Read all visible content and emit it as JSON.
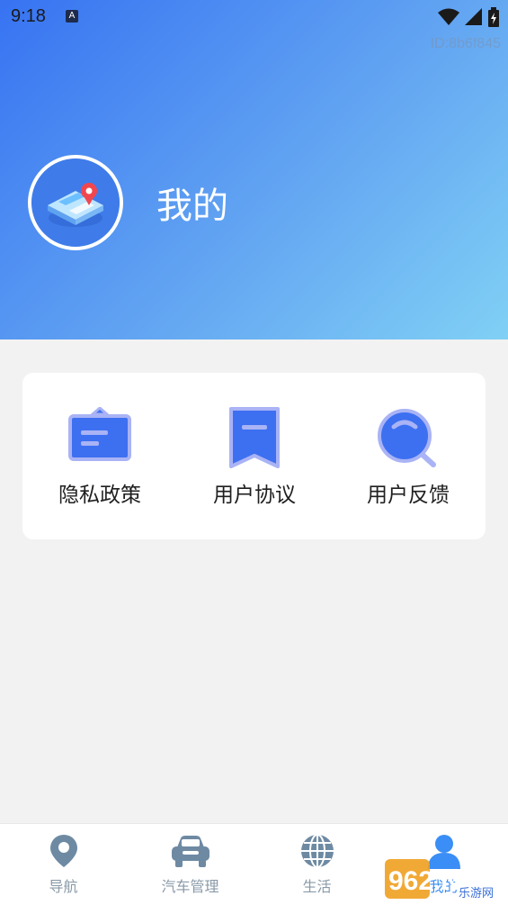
{
  "status_bar": {
    "time": "9:18",
    "notification_icon_letter": "A",
    "icons": [
      "wifi-icon",
      "signal-icon",
      "battery-icon"
    ]
  },
  "header": {
    "user_id": "ID:8b6f845",
    "title": "我的",
    "gradient_colors": [
      "#3773f2",
      "#80d0f5"
    ]
  },
  "menu": {
    "items": [
      {
        "label": "隐私政策",
        "icon": "privacy-policy-icon"
      },
      {
        "label": "用户协议",
        "icon": "bookmark-icon"
      },
      {
        "label": "用户反馈",
        "icon": "search-feedback-icon"
      }
    ],
    "icon_colors": {
      "fill": "#3d6ff1",
      "outline": "#a9b3f5"
    }
  },
  "tab_bar": {
    "tabs": [
      {
        "label": "导航",
        "icon": "location-pin-icon",
        "active": false
      },
      {
        "label": "汽车管理",
        "icon": "car-icon",
        "active": false
      },
      {
        "label": "生活",
        "icon": "globe-icon",
        "active": false
      },
      {
        "label": "我的",
        "icon": "person-icon",
        "active": true
      }
    ],
    "inactive_color": "#6e8aa3",
    "active_color": "#3a8ef5"
  },
  "watermark": {
    "text": "962.NET",
    "subtext": "乐游网"
  }
}
